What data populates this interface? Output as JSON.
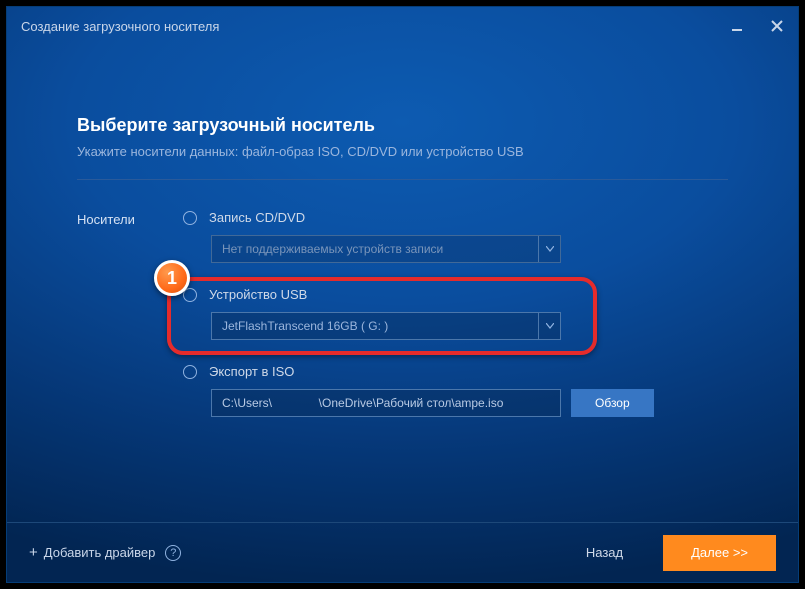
{
  "window": {
    "title": "Создание загрузочного носителя"
  },
  "page": {
    "heading": "Выберите загрузочный носитель",
    "subheading": "Укажите носители данных: файл-образ ISO, CD/DVD или устройство USB",
    "side_label": "Носители"
  },
  "options": {
    "cddvd": {
      "label": "Запись CD/DVD",
      "select_text": "Нет поддерживаемых устройств записи"
    },
    "usb": {
      "label": "Устройство USB",
      "select_text": "JetFlashTranscend 16GB  ( G: )"
    },
    "iso": {
      "label": "Экспорт в ISO",
      "path": "C:\\Users\\              \\OneDrive\\Рабочий стол\\ampe.iso",
      "browse": "Обзор"
    }
  },
  "annotation": {
    "badge": "1"
  },
  "footer": {
    "add_driver": "Добавить драйвер",
    "back": "Назад",
    "next": "Далее >>"
  }
}
